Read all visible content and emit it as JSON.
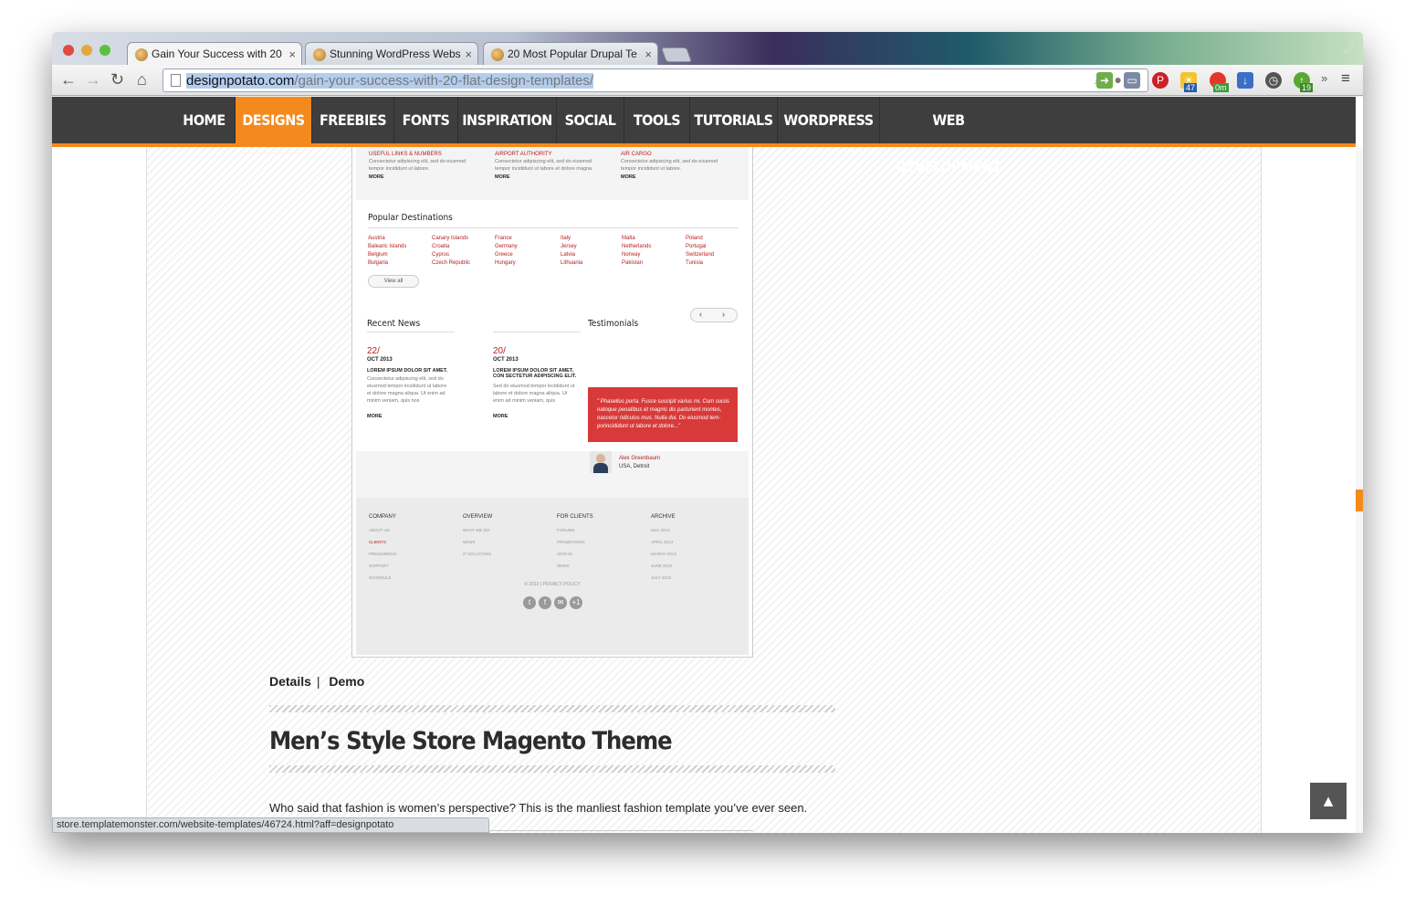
{
  "browser": {
    "tabs": [
      {
        "title": "Gain Your Success with 20",
        "active": true
      },
      {
        "title": "Stunning WordPress Webs",
        "active": false
      },
      {
        "title": "20 Most Popular Drupal Te",
        "active": false
      }
    ],
    "url_host": "designpotato.com",
    "url_path": "/gain-your-success-with-20-flat-design-templates/",
    "status_url": "store.templatemonster.com/website-templates/46724.html?aff=designpotato",
    "extensions": [
      {
        "name": "pinterest-icon",
        "badge": ""
      },
      {
        "name": "weather-icon",
        "badge": "47"
      },
      {
        "name": "timer-icon",
        "badge": "0m"
      },
      {
        "name": "download-icon",
        "badge": ""
      },
      {
        "name": "clock-icon",
        "badge": ""
      },
      {
        "name": "evernote-icon",
        "badge": "19"
      }
    ]
  },
  "site_nav": {
    "items": [
      {
        "label": "HOME",
        "active": false
      },
      {
        "label": "DESIGNS",
        "active": true
      },
      {
        "label": "FREEBIES",
        "active": false
      },
      {
        "label": "FONTS",
        "active": false
      },
      {
        "label": "INSPIRATION",
        "active": false
      },
      {
        "label": "SOCIAL",
        "active": false
      },
      {
        "label": "TOOLS",
        "active": false
      },
      {
        "label": "TUTORIALS",
        "active": false
      },
      {
        "label": "WORDPRESS",
        "active": false
      },
      {
        "label": "WEB DEVELOPMENT",
        "active": false
      }
    ],
    "accent_color": "#f48a1e"
  },
  "preview": {
    "cards": [
      {
        "title": "USEFUL LINKS & NUMBERS",
        "text": "Consectetur adipiscing elit, sed do eiusmod tempor incididunt ut labore.",
        "more": "MORE"
      },
      {
        "title": "AIRPORT AUTHORITY",
        "text": "Consectetur adipiscing elit, sed do eiusmod tempor incididunt ut labore et dolore magna",
        "more": "MORE"
      },
      {
        "title": "AIR CARGO",
        "text": "Consectetur adipiscing elit, sed do eiusmod tempor incididunt ut labore.",
        "more": "MORE"
      }
    ],
    "destinations_title": "Popular Destinations",
    "destinations": [
      [
        "Austria",
        "Balearic Islands",
        "Belgium",
        "Bulgaria"
      ],
      [
        "Canary Islands",
        "Croatia",
        "Cyprus",
        "Czech Republic"
      ],
      [
        "France",
        "Germany",
        "Greece",
        "Hungary"
      ],
      [
        "Italy",
        "Jersey",
        "Latvia",
        "Lithuania"
      ],
      [
        "Malta",
        "Netherlands",
        "Norway",
        "Pakistan"
      ],
      [
        "Poland",
        "Portugal",
        "Switzerland",
        "Tunisia"
      ]
    ],
    "view_all": "View all",
    "recent_news_title": "Recent News",
    "testimonials_title": "Testimonials",
    "news": [
      {
        "day": "22/",
        "month": "OCT 2013",
        "headline": "LOREM IPSUM DOLOR SIT AMET.",
        "text": "Consectetur adipiscing elit, sed do eiusmod tempor incididunt ut labore et dolore magna aliqua. Ut enim ad minim veniam, quis nos",
        "more": "MORE"
      },
      {
        "day": "20/",
        "month": "OCT 2013",
        "headline": "LOREM IPSUM DOLOR SIT AMET, CON SECTETUR ADIPISCING ELIT.",
        "text": "Sed do eiusmod tempor incididunt ut labore et dolore magna aliqua. Ut enim ad minim veniam, quis",
        "more": "MORE"
      }
    ],
    "testimonial_quote": "\" Phasellus porta. Fusce suscipit varius mi. Cum sociis natoque penatibus et magnis dis parturient montes, nascetur ridiculus mus. Nulla dui. Do eiusmod tem-porincididunt ut labore et dolore...\"",
    "testimonial_name": "Alex Greenbaum",
    "testimonial_location": "USA, Detroit",
    "footer_columns": [
      {
        "title": "COMPANY",
        "items": [
          "ABOUT US",
          "CLIENTS",
          "PRESS/MEDIA",
          "SUPPORT",
          "SCHEDULE"
        ]
      },
      {
        "title": "OVERVIEW",
        "items": [
          "WHAT WE DO",
          "NEWS",
          "IT SOLUTIONS"
        ]
      },
      {
        "title": "FOR CLIENTS",
        "items": [
          "FORUMS",
          "PROMOTIONS",
          "SIGN IN",
          "NEWS"
        ]
      },
      {
        "title": "ARCHIVE",
        "items": [
          "MAY 2013",
          "APRIL 2013",
          "MARCH 2013",
          "JUNE 2013",
          "JULY 2013"
        ]
      }
    ],
    "copyright": "© 2013 | PRIVACY POLICY",
    "social": [
      "t",
      "f",
      "✉",
      "+1"
    ]
  },
  "post": {
    "details_label": "Details",
    "separator": "|",
    "demo_label": "Demo",
    "title": "Men’s Style Store Magento Theme",
    "body": "Who said that fashion is women’s perspective? This is the manliest fashion template you’ve ever seen."
  },
  "back_to_top": "▲"
}
